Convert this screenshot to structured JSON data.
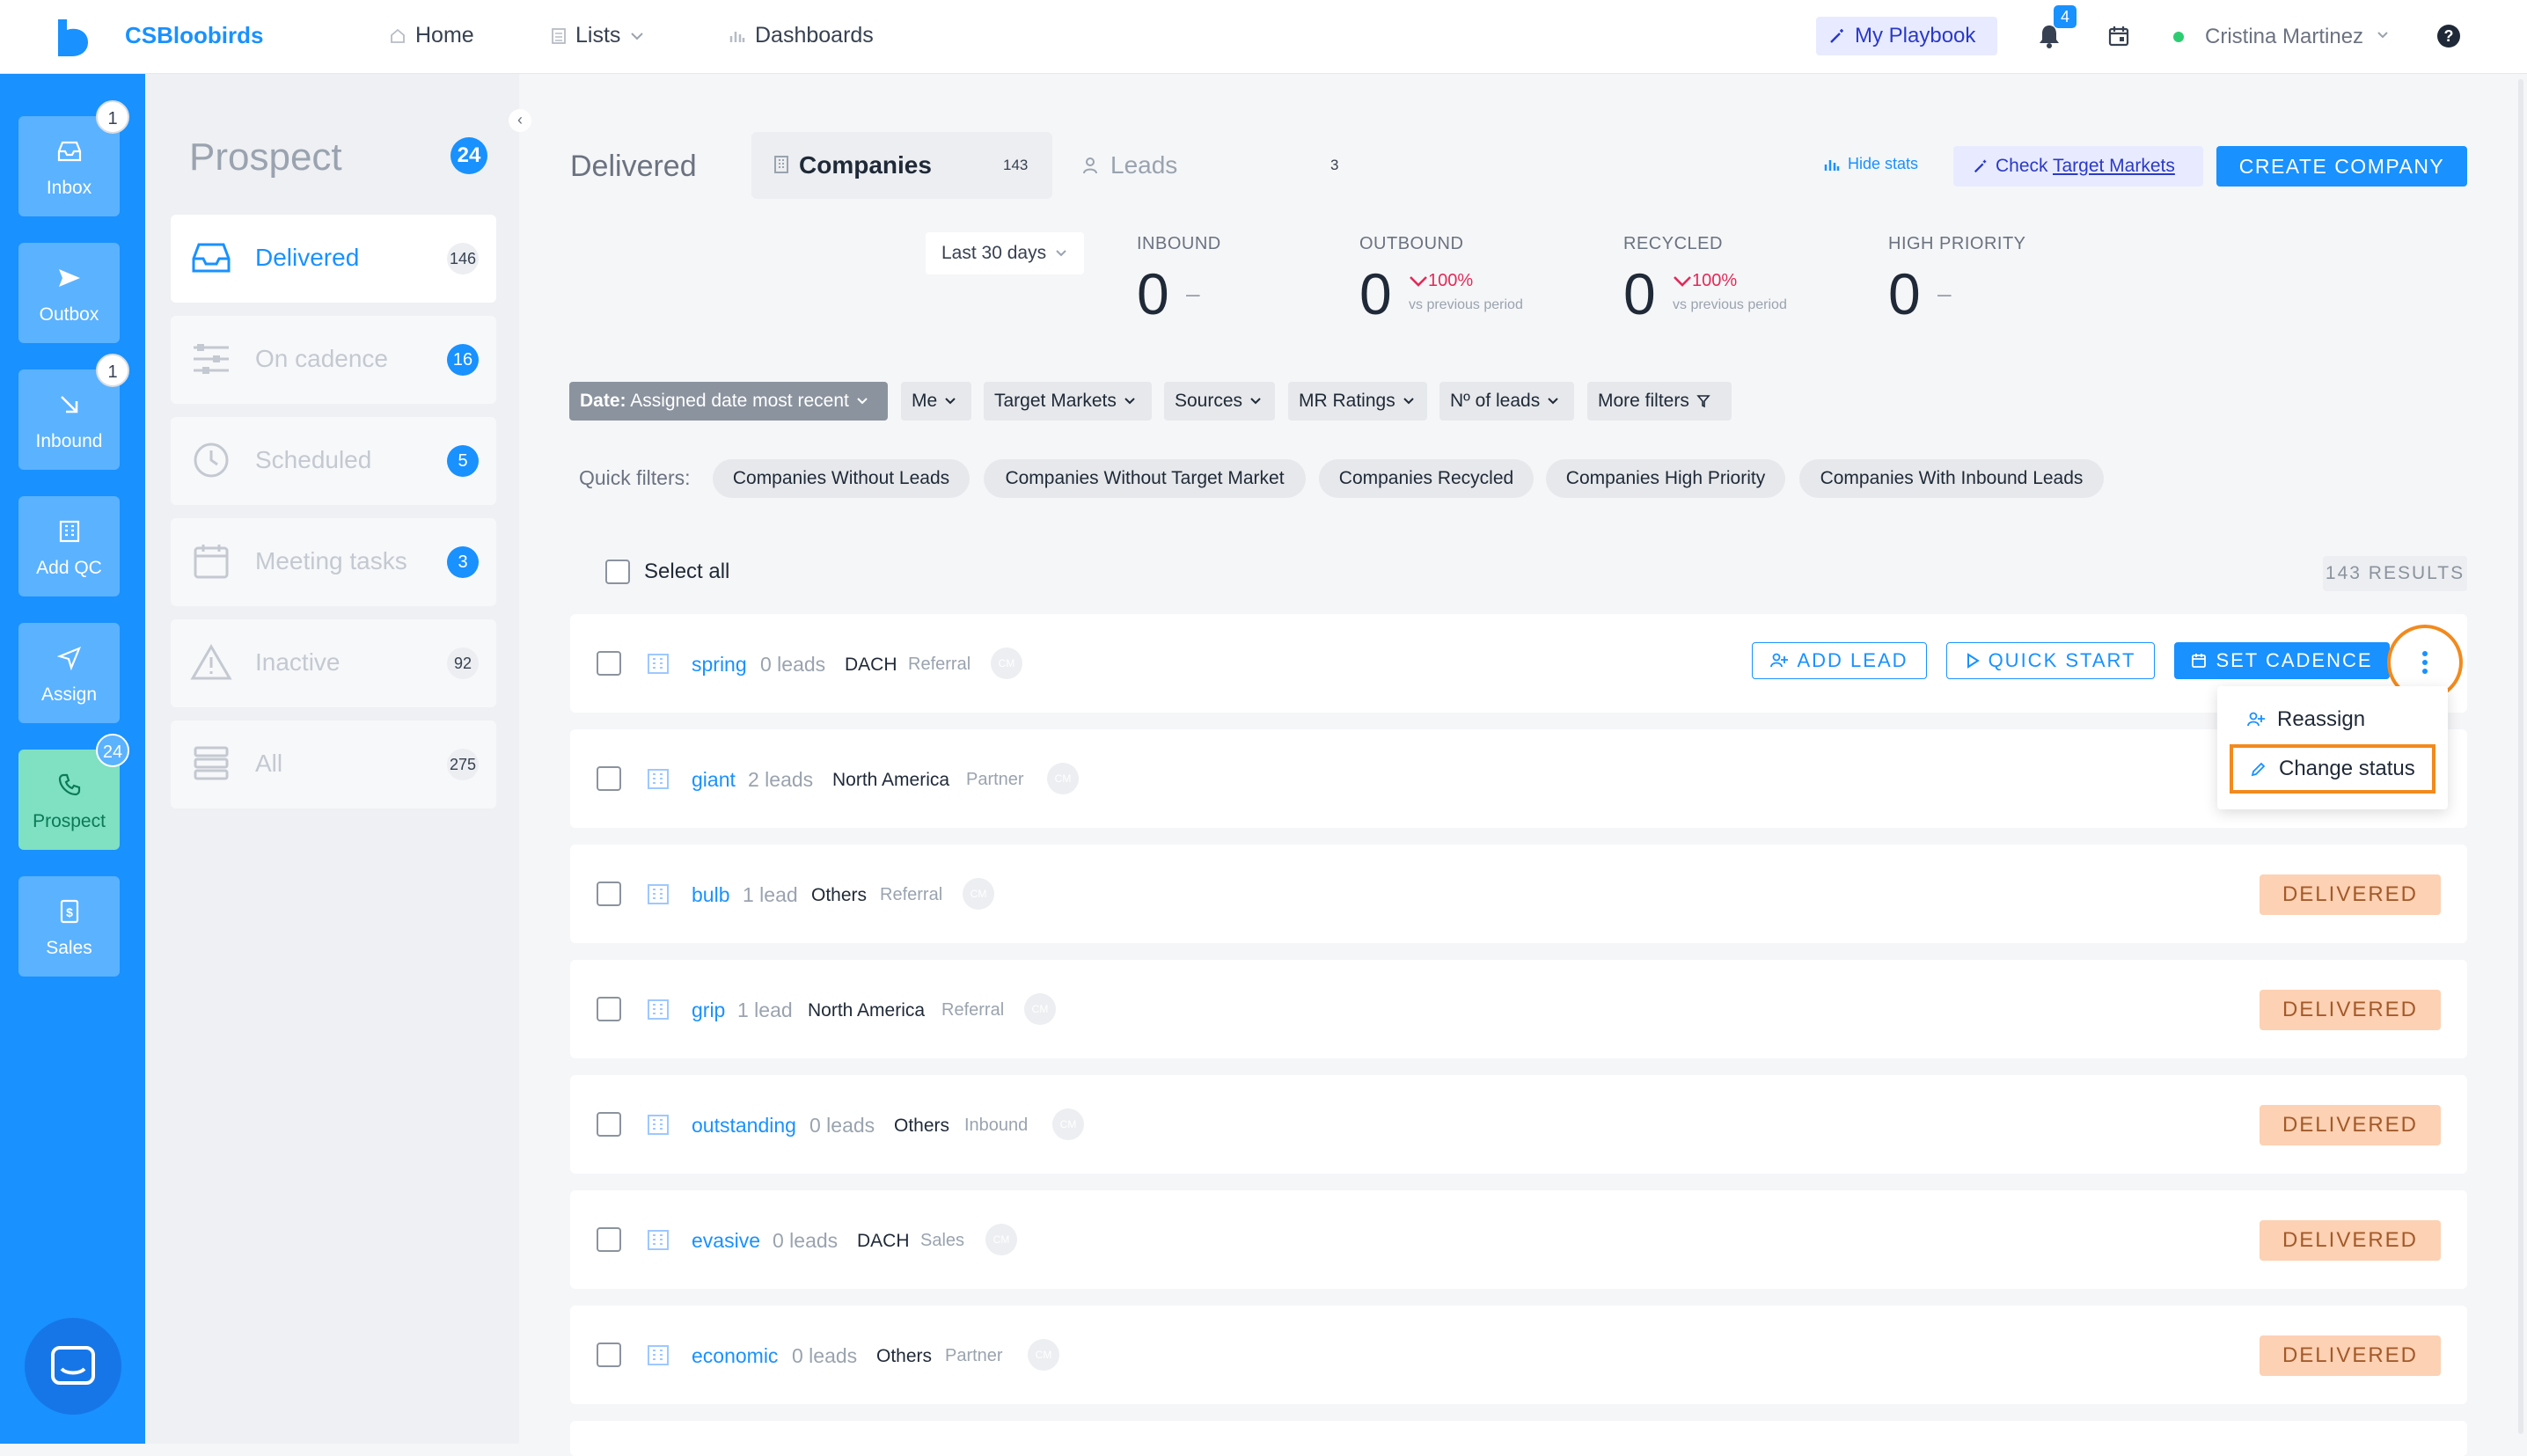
{
  "app": {
    "brand": "CSBloobirds"
  },
  "topnav": {
    "items": [
      {
        "label": "Home",
        "icon": "home-icon"
      },
      {
        "label": "Lists",
        "icon": "list-icon"
      },
      {
        "label": "Dashboards",
        "icon": "bar-chart-icon"
      }
    ],
    "playbook_label": "My Playbook",
    "notifications_count": "4",
    "user_name": "Cristina Martinez",
    "help_label": "?"
  },
  "rail": {
    "items": [
      {
        "label": "Inbox",
        "badge": "1"
      },
      {
        "label": "Outbox",
        "badge": ""
      },
      {
        "label": "Inbound",
        "badge": "1"
      },
      {
        "label": "Add QC",
        "badge": ""
      },
      {
        "label": "Assign",
        "badge": ""
      },
      {
        "label": "Prospect",
        "badge": "24"
      },
      {
        "label": "Sales",
        "badge": ""
      }
    ]
  },
  "sidebar": {
    "title": "Prospect",
    "title_count": "24",
    "items": [
      {
        "label": "Delivered",
        "count": "146"
      },
      {
        "label": "On cadence",
        "count": "16"
      },
      {
        "label": "Scheduled",
        "count": "5"
      },
      {
        "label": "Meeting tasks",
        "count": "3"
      },
      {
        "label": "Inactive",
        "count": "92"
      },
      {
        "label": "All",
        "count": "275"
      }
    ]
  },
  "main": {
    "title": "Delivered",
    "tabs": [
      {
        "label": "Companies",
        "count": "143"
      },
      {
        "label": "Leads",
        "count": "3"
      }
    ],
    "hide_stats": "Hide stats",
    "check_tm_prefix": "Check ",
    "check_tm_link": "Target Markets",
    "create_company": "CREATE COMPANY",
    "period": "Last 30 days",
    "stats": [
      {
        "label": "INBOUND",
        "value": "0",
        "change": "",
        "sub": ""
      },
      {
        "label": "OUTBOUND",
        "value": "0",
        "change": "100%",
        "sub": "vs previous period"
      },
      {
        "label": "RECYCLED",
        "value": "0",
        "change": "100%",
        "sub": "vs previous period"
      },
      {
        "label": "HIGH PRIORITY",
        "value": "0",
        "change": "",
        "sub": ""
      }
    ],
    "filters": [
      {
        "bold": "Date:",
        "label": " Assigned date most recent"
      },
      {
        "bold": "",
        "label": "Me"
      },
      {
        "bold": "",
        "label": "Target Markets"
      },
      {
        "bold": "",
        "label": "Sources"
      },
      {
        "bold": "",
        "label": "MR Ratings"
      },
      {
        "bold": "",
        "label": "Nº of leads"
      },
      {
        "bold": "",
        "label": "More filters"
      }
    ],
    "quick_filters_label": "Quick filters:",
    "quick_filters": [
      "Companies Without Leads",
      "Companies Without Target Market",
      "Companies Recycled",
      "Companies High Priority",
      "Companies With Inbound Leads"
    ],
    "select_all": "Select all",
    "results": "143 RESULTS",
    "row_actions": {
      "add_lead": "ADD LEAD",
      "quick_start": "QUICK START",
      "set_cadence": "SET CADENCE"
    },
    "context_menu": {
      "reassign": "Reassign",
      "change_status": "Change status"
    },
    "rows": [
      {
        "name": "spring",
        "leads": "0 leads",
        "region": "DACH",
        "source": "Referral",
        "avatar": "CM",
        "status": ""
      },
      {
        "name": "giant",
        "leads": "2 leads",
        "region": "North America",
        "source": "Partner",
        "avatar": "CM",
        "status": ""
      },
      {
        "name": "bulb",
        "leads": "1 lead",
        "region": "Others",
        "source": "Referral",
        "avatar": "CM",
        "status": "DELIVERED"
      },
      {
        "name": "grip",
        "leads": "1 lead",
        "region": "North America",
        "source": "Referral",
        "avatar": "CM",
        "status": "DELIVERED"
      },
      {
        "name": "outstanding",
        "leads": "0 leads",
        "region": "Others",
        "source": "Inbound",
        "avatar": "CM",
        "status": "DELIVERED"
      },
      {
        "name": "evasive",
        "leads": "0 leads",
        "region": "DACH",
        "source": "Sales",
        "avatar": "CM",
        "status": "DELIVERED"
      },
      {
        "name": "economic",
        "leads": "0 leads",
        "region": "Others",
        "source": "Partner",
        "avatar": "CM",
        "status": "DELIVERED"
      }
    ]
  },
  "colors": {
    "primary": "#1991ff",
    "status_delivered_bg": "#fdd1b3",
    "highlight": "#f28a1d",
    "negative": "#e22a58"
  }
}
